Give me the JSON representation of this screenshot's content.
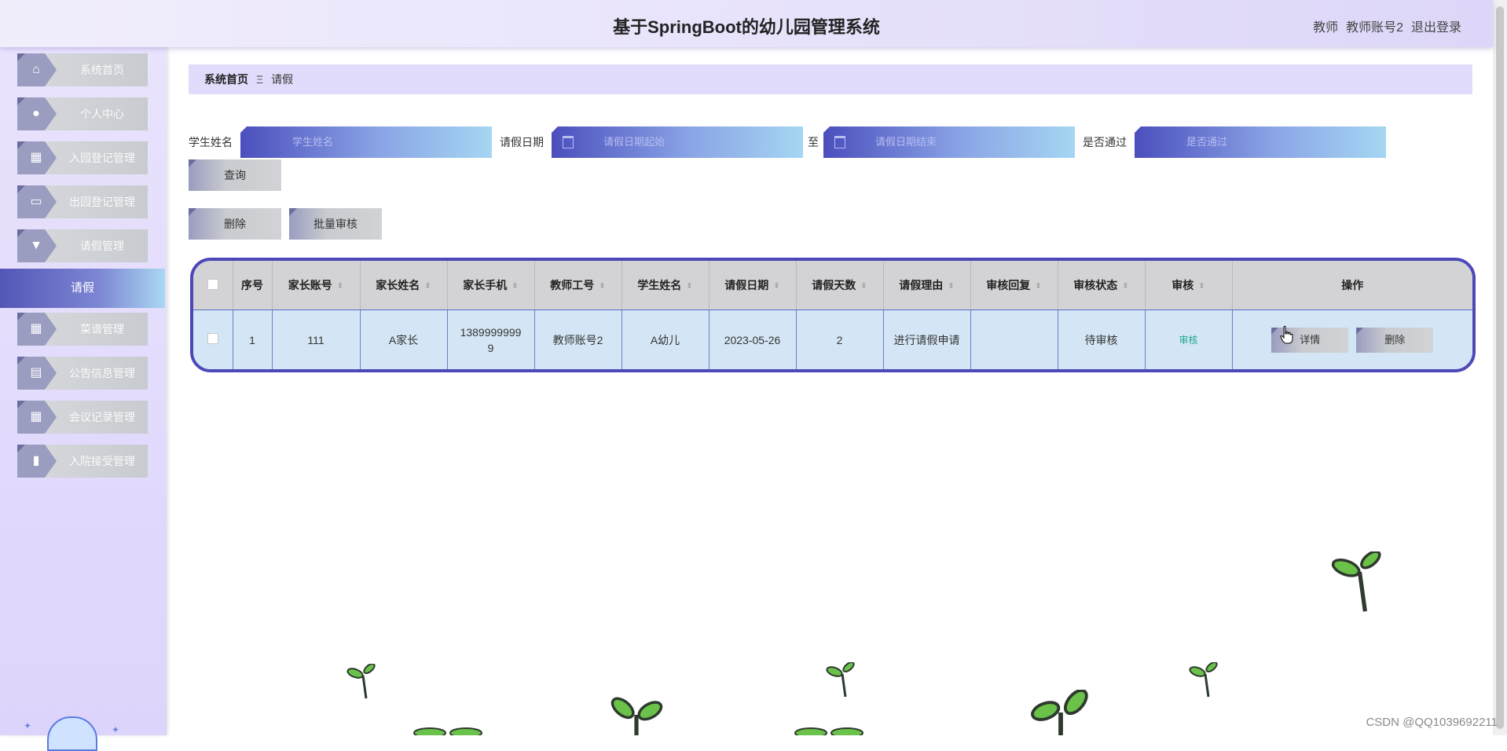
{
  "header": {
    "title": "基于SpringBoot的幼儿园管理系统",
    "role": "教师",
    "account": "教师账号2",
    "logout": "退出登录"
  },
  "sidebar": {
    "items": [
      {
        "label": "系统首页",
        "icon": "home-icon"
      },
      {
        "label": "个人中心",
        "icon": "user-icon"
      },
      {
        "label": "入园登记管理",
        "icon": "grid-icon"
      },
      {
        "label": "出园登记管理",
        "icon": "monitor-icon"
      },
      {
        "label": "请假管理",
        "icon": "tag-icon"
      },
      {
        "label": "菜谱管理",
        "icon": "grid-icon"
      },
      {
        "label": "公告信息管理",
        "icon": "print-icon"
      },
      {
        "label": "会议记录管理",
        "icon": "grid-icon"
      },
      {
        "label": "入院接受管理",
        "icon": "book-icon"
      }
    ],
    "active": "请假"
  },
  "breadcrumb": {
    "home": "系统首页",
    "separator": "Ξ",
    "current": "请假"
  },
  "search": {
    "student_label": "学生姓名",
    "student_placeholder": "学生姓名",
    "date_label": "请假日期",
    "date_start_placeholder": "请假日期起始",
    "to_label": "至",
    "date_end_placeholder": "请假日期结束",
    "pass_label": "是否通过",
    "pass_placeholder": "是否通过",
    "query_button": "查询"
  },
  "actions": {
    "delete_button": "删除",
    "batch_audit_button": "批量审核"
  },
  "table": {
    "headers": [
      "序号",
      "家长账号",
      "家长姓名",
      "家长手机",
      "教师工号",
      "学生姓名",
      "请假日期",
      "请假天数",
      "请假理由",
      "审核回复",
      "审核状态",
      "审核",
      "操作"
    ],
    "rows": [
      {
        "index": "1",
        "parent_account": "111",
        "parent_name": "A家长",
        "parent_phone_line1": "1389999999",
        "parent_phone_line2": "9",
        "teacher_id": "教师账号2",
        "student_name": "A幼儿",
        "leave_date": "2023-05-26",
        "leave_days": "2",
        "reason": "进行请假申请",
        "audit_reply": "",
        "audit_status": "待审核",
        "audit_action": "审核",
        "detail_button": "详情",
        "delete_button": "删除"
      }
    ]
  },
  "watermark": "CSDN @QQ1039692211"
}
